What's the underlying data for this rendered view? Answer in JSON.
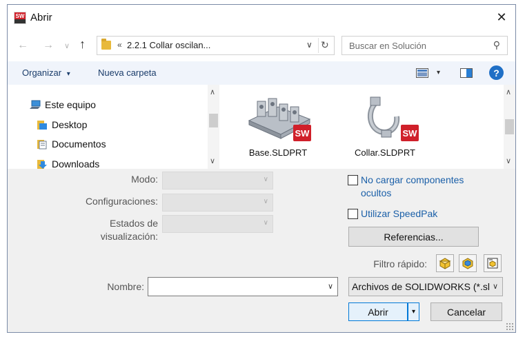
{
  "window": {
    "title": "Abrir",
    "close_glyph": "✕"
  },
  "nav": {
    "back_glyph": "←",
    "forward_glyph": "→",
    "recent_glyph": "∨",
    "up_glyph": "↑",
    "address_chevron": "«",
    "address_path": "2.2.1 Collar oscilan...",
    "address_dropdown": "∨",
    "refresh_glyph": "↻",
    "search_placeholder": "Buscar en Solución",
    "search_glyph": "⚲"
  },
  "toolbar": {
    "organize_label": "Organizar",
    "organize_caret": "▾",
    "new_folder_label": "Nueva carpeta",
    "view_caret": "▾",
    "help_glyph": "?"
  },
  "tree": {
    "items": [
      {
        "label": "Este equipo",
        "icon": "computer-icon"
      },
      {
        "label": "Desktop",
        "icon": "desktop-folder-icon"
      },
      {
        "label": "Documentos",
        "icon": "documents-folder-icon"
      },
      {
        "label": "Downloads",
        "icon": "downloads-folder-icon"
      }
    ]
  },
  "scroll": {
    "up_glyph": "∧",
    "down_glyph": "∨"
  },
  "files": [
    {
      "name": "Base.SLDPRT",
      "icon": "part-base-icon"
    },
    {
      "name": "Collar.SLDPRT",
      "icon": "part-collar-icon"
    }
  ],
  "options": {
    "mode_label": "Modo:",
    "config_label": "Configuraciones:",
    "display_states_label_1": "Estados de",
    "display_states_label_2": "visualización:",
    "combo_caret": "∨"
  },
  "checks": {
    "no_load_hidden": "No cargar componentes ocultos",
    "speedpak": "Utilizar SpeedPak"
  },
  "buttons": {
    "references": "Referencias...",
    "open": "Abrir",
    "open_caret": "▾",
    "cancel": "Cancelar"
  },
  "quick_filter": {
    "label": "Filtro rápido:"
  },
  "filename": {
    "label": "Nombre:",
    "value": "",
    "caret": "∨"
  },
  "filetype": {
    "value": "Archivos de SOLIDWORKS (*.slc",
    "caret": "∨"
  },
  "colors": {
    "accent": "#0078d7",
    "link": "#1a5fa8",
    "sw_red": "#d0202a"
  }
}
